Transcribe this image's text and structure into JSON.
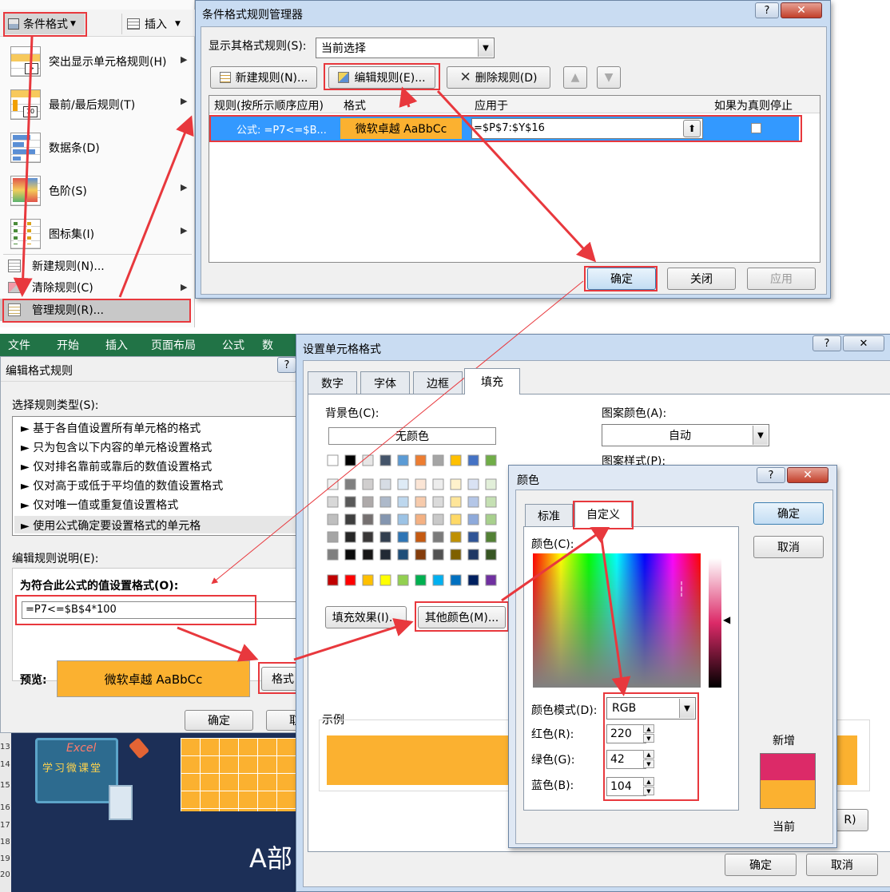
{
  "cf_menu": {
    "button_label": "条件格式",
    "insert_label": "插入",
    "items": [
      {
        "label": "突出显示单元格规则(H)"
      },
      {
        "label": "最前/最后规则(T)"
      },
      {
        "label": "数据条(D)"
      },
      {
        "label": "色阶(S)"
      },
      {
        "label": "图标集(I)"
      }
    ],
    "new_rule": "新建规则(N)...",
    "clear_rule": "清除规则(C)",
    "manage_rule": "管理规则(R)..."
  },
  "manager": {
    "title": "条件格式规则管理器",
    "show_label": "显示其格式规则(S):",
    "show_value": "当前选择",
    "new_btn": "新建规则(N)...",
    "edit_btn": "编辑规则(E)...",
    "delete_btn": "删除规则(D)",
    "col_rule": "规则(按所示顺序应用)",
    "col_format": "格式",
    "col_applies": "应用于",
    "col_stop": "如果为真则停止",
    "row_rule": "公式: =P7<=$B...",
    "row_preview": "微软卓越  AaBbCc",
    "row_applies": "=$P$7:$Y$16",
    "ok": "确定",
    "close": "关闭",
    "apply": "应用"
  },
  "ribbon": {
    "tabs": [
      "文件",
      "开始",
      "插入",
      "页面布局",
      "公式",
      "数"
    ]
  },
  "edit_rule": {
    "title": "编辑格式规则",
    "select_type_label": "选择规则类型(S):",
    "types": [
      "► 基于各自值设置所有单元格的格式",
      "► 只为包含以下内容的单元格设置格式",
      "► 仅对排名靠前或靠后的数值设置格式",
      "► 仅对高于或低于平均值的数值设置格式",
      "► 仅对唯一值或重复值设置格式",
      "► 使用公式确定要设置格式的单元格"
    ],
    "desc_label": "编辑规则说明(E):",
    "formula_label": "为符合此公式的值设置格式(O):",
    "formula_value": "=P7<=$B$4*100",
    "preview_label": "预览:",
    "preview_text": "微软卓越  AaBbCc",
    "format_btn": "格式",
    "ok": "确定",
    "cut_btn": "取"
  },
  "format_cells": {
    "title": "设置单元格格式",
    "tabs": [
      "数字",
      "字体",
      "边框",
      "填充"
    ],
    "bg_label": "背景色(C):",
    "no_color": "无颜色",
    "pattern_color_label": "图案颜色(A):",
    "pattern_color_value": "自动",
    "pattern_style_label": "图案样式(P):",
    "fill_effects": "填充效果(I)...",
    "more_colors": "其他颜色(M)...",
    "sample_label": "示例",
    "ok": "确定",
    "cancel": "取消",
    "r_button": "R)",
    "row_numbers": [
      "13",
      "14",
      "15",
      "16",
      "17",
      "18",
      "19",
      "20"
    ],
    "bg_text": "A部",
    "logo_text": "Excel",
    "logo_sub": "学习微课堂",
    "swatch_rows": [
      [
        "#ffffff",
        "#000000",
        "#e7e6e6",
        "#44546a",
        "#5b9bd5",
        "#ed7d31",
        "#a5a5a5",
        "#ffc000",
        "#4472c4",
        "#70ad47"
      ],
      [
        "#f2f2f2",
        "#7f7f7f",
        "#d0cece",
        "#d6dce4",
        "#deebf6",
        "#fbe5d5",
        "#ededed",
        "#fff2cc",
        "#d9e2f3",
        "#e2efd9"
      ],
      [
        "#d8d8d8",
        "#595959",
        "#aeaaaa",
        "#adb9ca",
        "#bdd7ee",
        "#f7cbac",
        "#dbdbdb",
        "#fee599",
        "#b4c6e7",
        "#c5e0b3"
      ],
      [
        "#bfbfbf",
        "#3f3f3f",
        "#757070",
        "#8496b0",
        "#9cc3e5",
        "#f4b183",
        "#c9c9c9",
        "#ffd966",
        "#8eaadb",
        "#a8d08d"
      ],
      [
        "#a5a5a5",
        "#262626",
        "#3a3838",
        "#323f4f",
        "#2e75b5",
        "#c55a11",
        "#7b7b7b",
        "#bf9000",
        "#2f5496",
        "#538135"
      ],
      [
        "#7f7f7f",
        "#0c0c0c",
        "#171616",
        "#222a35",
        "#1e4e79",
        "#843c0b",
        "#525252",
        "#7f6000",
        "#1f3864",
        "#375623"
      ]
    ],
    "standard_colors": [
      "#c00000",
      "#ff0000",
      "#ffc000",
      "#ffff00",
      "#92d050",
      "#00b050",
      "#00b0f0",
      "#0070c0",
      "#002060",
      "#7030a0"
    ]
  },
  "color_dialog": {
    "title": "颜色",
    "tab_standard": "标准",
    "tab_custom": "自定义",
    "colors_label": "颜色(C):",
    "mode_label": "颜色模式(D):",
    "mode_value": "RGB",
    "red_label": "红色(R):",
    "green_label": "绿色(G):",
    "blue_label": "蓝色(B):",
    "red": "220",
    "green": "42",
    "blue": "104",
    "ok": "确定",
    "cancel": "取消",
    "new_label": "新增",
    "current_label": "当前",
    "new_color": "#dc2a68",
    "current_color": "#fbb130"
  },
  "colors": {
    "accent_orange": "#fbb130",
    "highlight_red": "#e8383d",
    "excel_green": "#217346",
    "selection_blue": "#3399ff"
  }
}
